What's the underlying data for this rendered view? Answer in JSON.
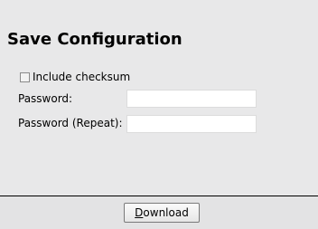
{
  "dialog": {
    "title": "Save Configuration"
  },
  "checksum": {
    "label": "Include checksum",
    "checked": false
  },
  "password": {
    "label": "Password:",
    "value": ""
  },
  "password_repeat": {
    "label": "Password (Repeat):",
    "value": ""
  },
  "footer": {
    "download_mnemonic": "D",
    "download_rest": "ownload"
  }
}
